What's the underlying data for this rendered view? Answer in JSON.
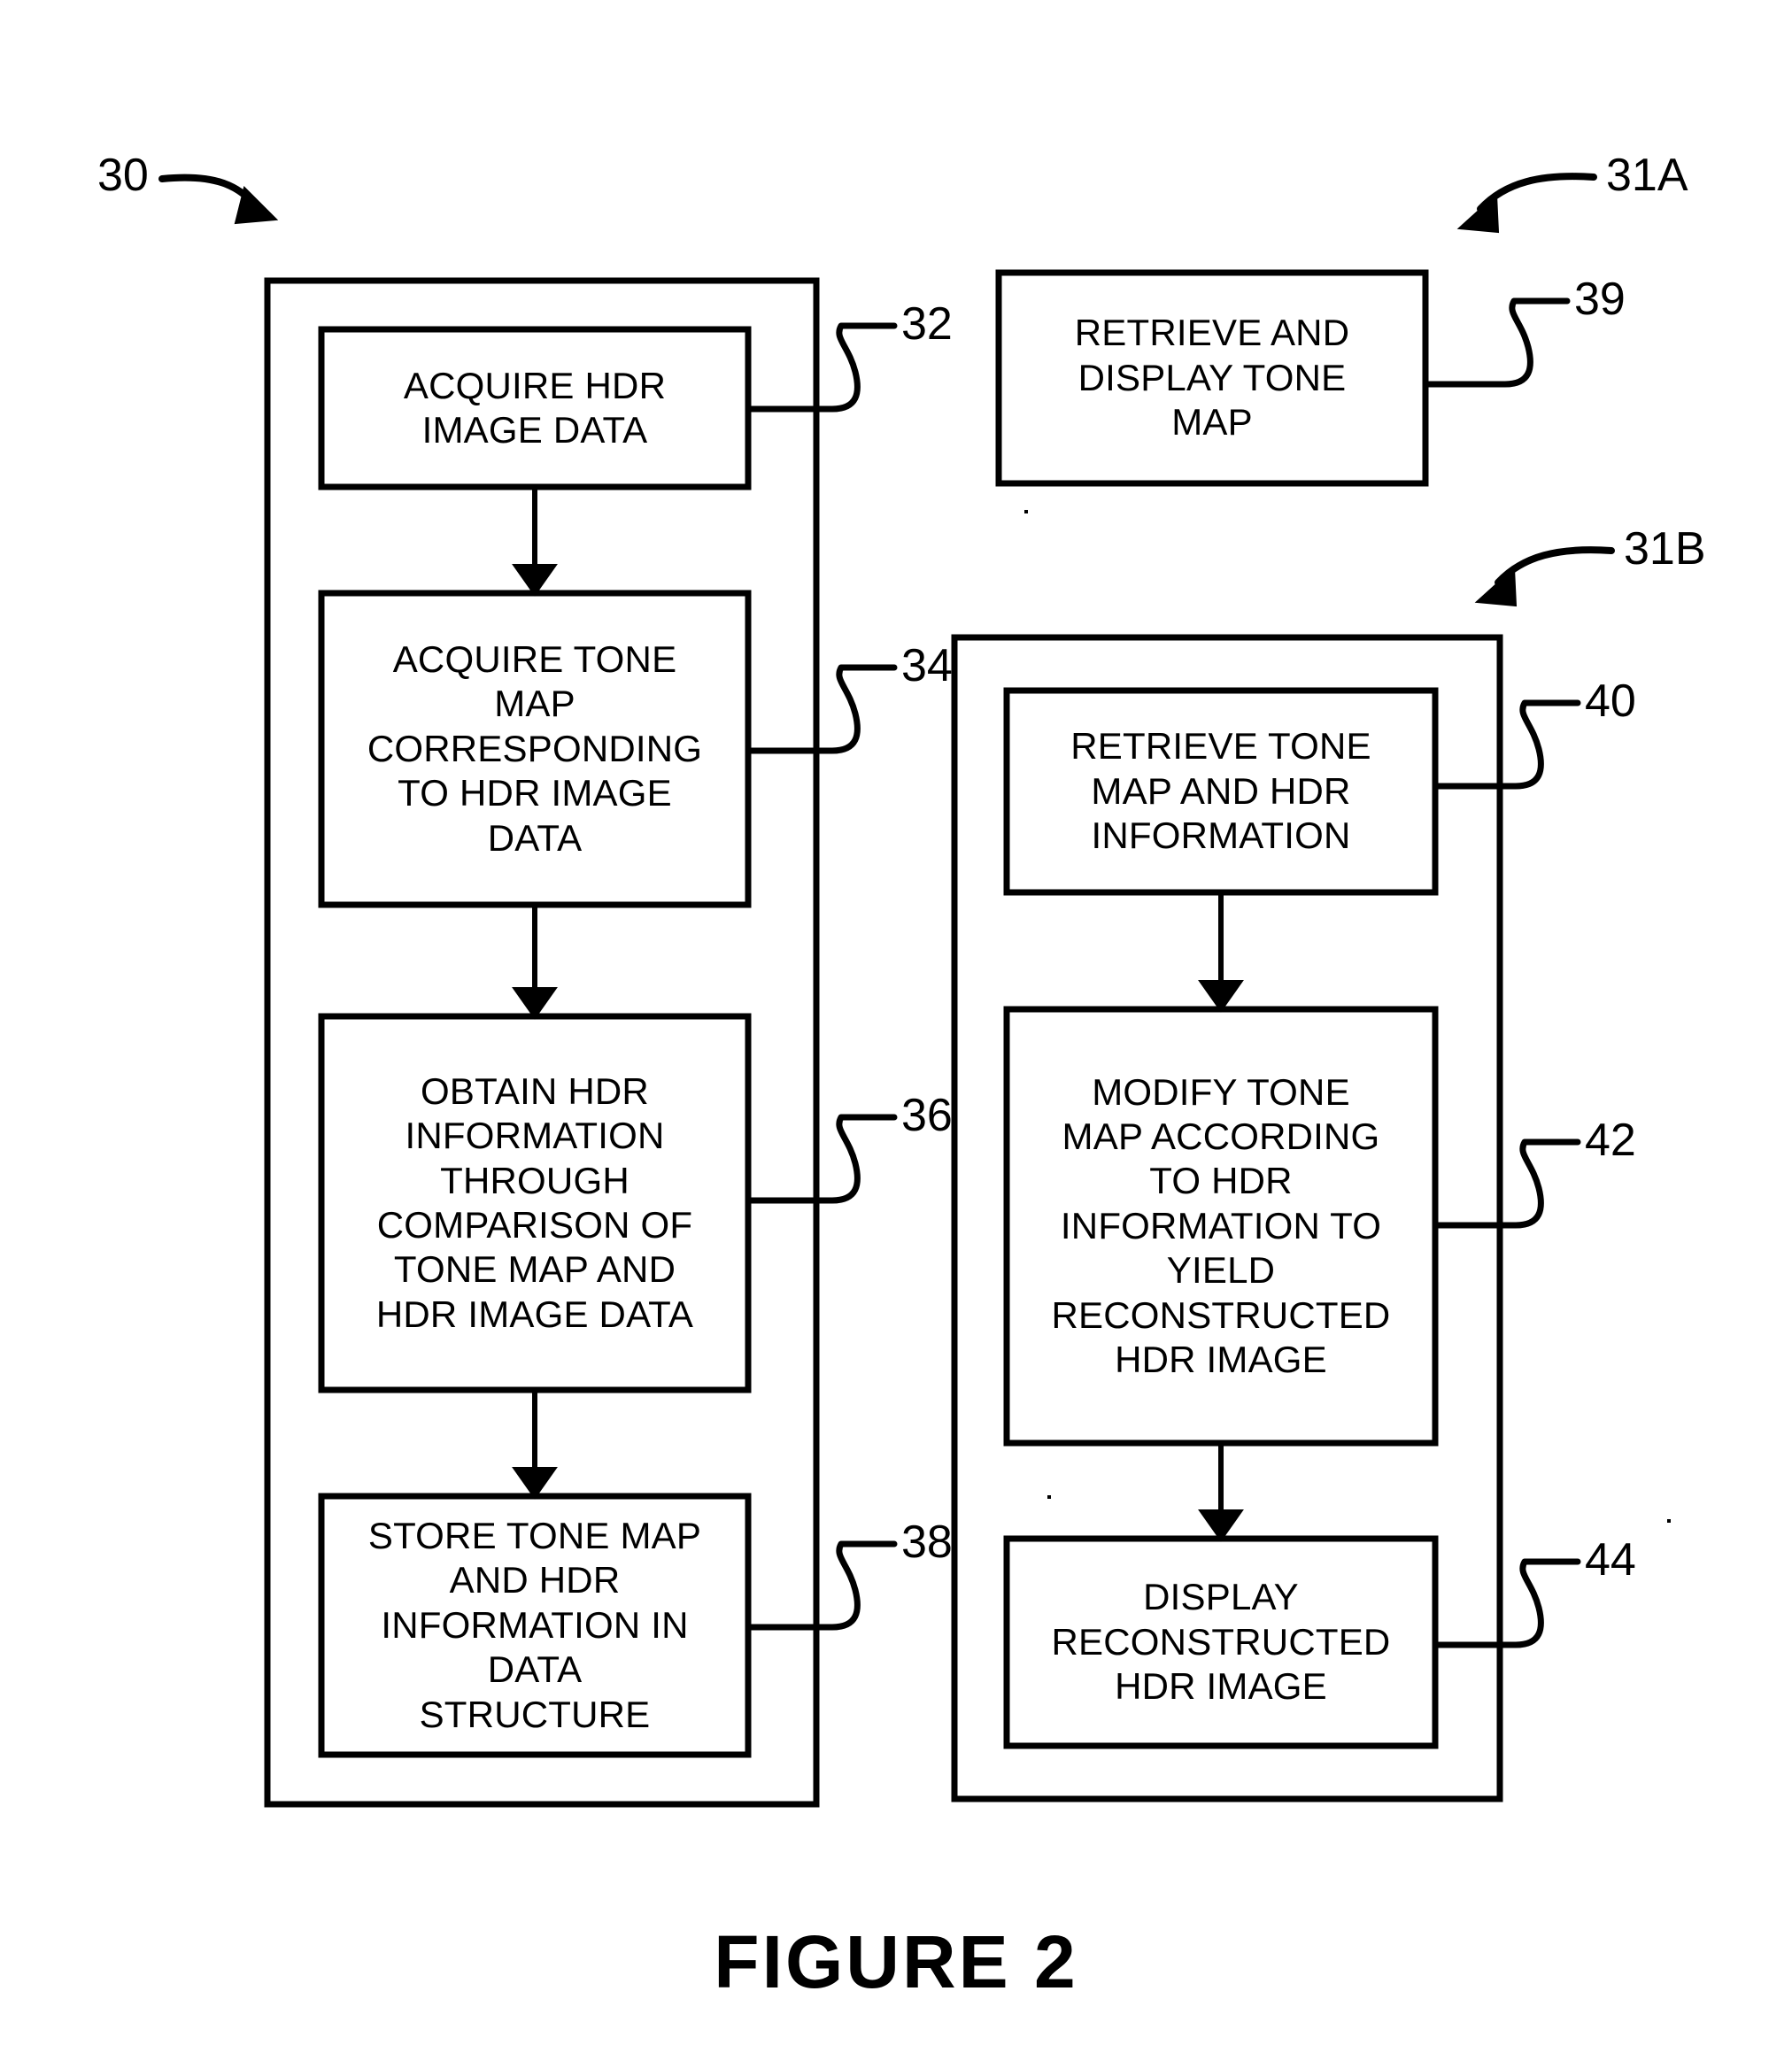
{
  "figure": {
    "caption": "FIGURE 2",
    "overall_ref": "30",
    "group_refs": {
      "encode_side": "31A",
      "decode_side": "31B"
    }
  },
  "diagram": {
    "type": "flowchart",
    "containers": [
      {
        "id": "container-encode",
        "ref": "30",
        "note": "outer process box enclosing steps 32, 34, 36, 38"
      },
      {
        "id": "container-decode",
        "ref": "31B",
        "note": "outer process box enclosing steps 40, 42, 44"
      }
    ],
    "standalone_block_ref": "31A",
    "blocks": [
      {
        "id": "block-32",
        "ref": "32",
        "column": "left",
        "lines": [
          "ACQUIRE HDR",
          "IMAGE DATA"
        ]
      },
      {
        "id": "block-34",
        "ref": "34",
        "column": "left",
        "lines": [
          "ACQUIRE TONE",
          "MAP",
          "CORRESPONDING",
          "TO HDR IMAGE",
          "DATA"
        ]
      },
      {
        "id": "block-36",
        "ref": "36",
        "column": "left",
        "lines": [
          "OBTAIN HDR",
          "INFORMATION",
          "THROUGH",
          "COMPARISON OF",
          "TONE MAP AND",
          "HDR IMAGE DATA"
        ]
      },
      {
        "id": "block-38",
        "ref": "38",
        "column": "left",
        "lines": [
          "STORE TONE MAP",
          "AND HDR",
          "INFORMATION IN",
          "DATA",
          "STRUCTURE"
        ]
      },
      {
        "id": "block-39",
        "ref": "39",
        "column": "right-top",
        "lines": [
          "RETRIEVE AND",
          "DISPLAY TONE",
          "MAP"
        ]
      },
      {
        "id": "block-40",
        "ref": "40",
        "column": "right",
        "lines": [
          "RETRIEVE TONE",
          "MAP AND HDR",
          "INFORMATION"
        ]
      },
      {
        "id": "block-42",
        "ref": "42",
        "column": "right",
        "lines": [
          "MODIFY TONE",
          "MAP ACCORDING",
          "TO HDR",
          "INFORMATION TO",
          "YIELD",
          "RECONSTRUCTED",
          "HDR IMAGE"
        ]
      },
      {
        "id": "block-44",
        "ref": "44",
        "column": "right",
        "lines": [
          "DISPLAY",
          "RECONSTRUCTED",
          "HDR IMAGE"
        ]
      }
    ],
    "flow_arrows": [
      {
        "from": "block-32",
        "to": "block-34"
      },
      {
        "from": "block-34",
        "to": "block-36"
      },
      {
        "from": "block-36",
        "to": "block-38"
      },
      {
        "from": "block-40",
        "to": "block-42"
      },
      {
        "from": "block-42",
        "to": "block-44"
      }
    ],
    "colors": {
      "ink": "#000000",
      "paper": "#ffffff"
    }
  }
}
